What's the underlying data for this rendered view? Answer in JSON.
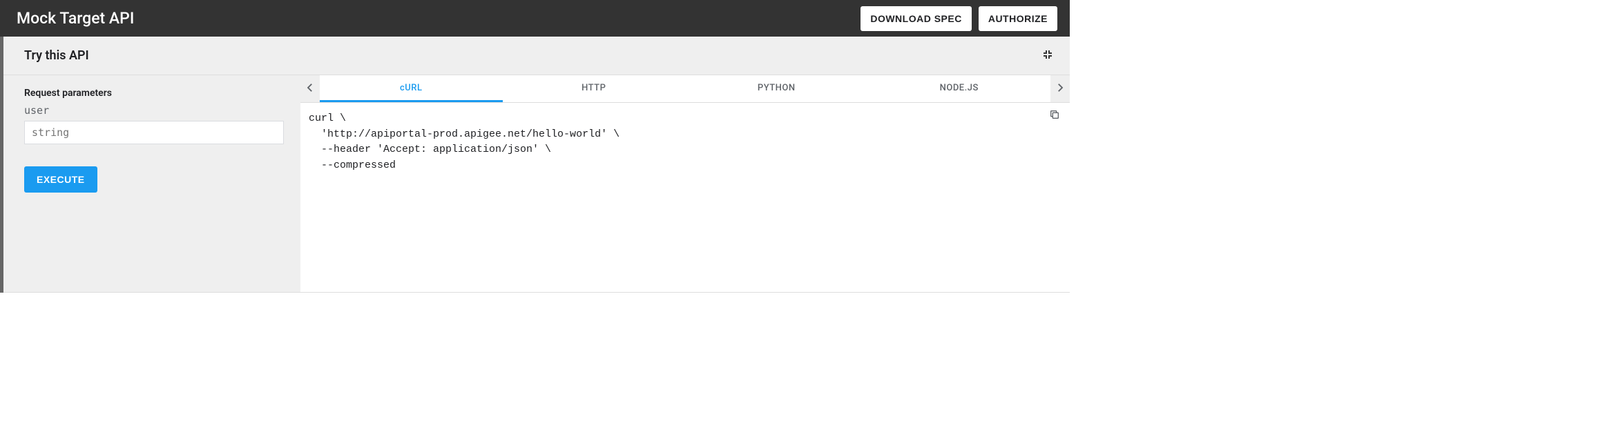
{
  "topbar": {
    "title": "Mock Target API",
    "download_label": "DOWNLOAD SPEC",
    "authorize_label": "AUTHORIZE"
  },
  "panel": {
    "title": "Try this API"
  },
  "request": {
    "section_label": "Request parameters",
    "param_name": "user",
    "param_placeholder": "string",
    "execute_label": "EXECUTE"
  },
  "tabs": {
    "items": [
      "cURL",
      "HTTP",
      "PYTHON",
      "NODE.JS"
    ],
    "active_index": 0
  },
  "code": {
    "curl": "curl \\\n  'http://apiportal-prod.apigee.net/hello-world' \\\n  --header 'Accept: application/json' \\\n  --compressed"
  }
}
